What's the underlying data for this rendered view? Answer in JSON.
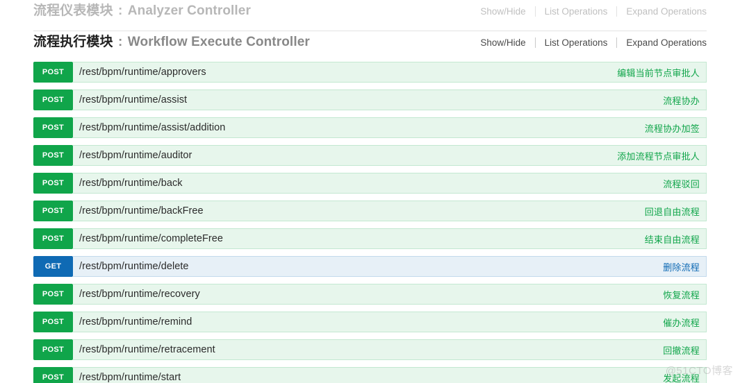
{
  "sections": [
    {
      "id": "analyzer",
      "title_cn": "流程仪表模块",
      "title_sep": " : ",
      "title_en": "Analyzer Controller",
      "state": "collapsed",
      "options": {
        "show_hide": "Show/Hide",
        "list_operations": "List Operations",
        "expand_operations": "Expand Operations"
      }
    },
    {
      "id": "workflow-execute",
      "title_cn": "流程执行模块",
      "title_sep": " : ",
      "title_en": "Workflow Execute Controller",
      "state": "expanded",
      "options": {
        "show_hide": "Show/Hide",
        "list_operations": "List Operations",
        "expand_operations": "Expand Operations"
      }
    }
  ],
  "endpoints": [
    {
      "method": "POST",
      "path": "/rest/bpm/runtime/approvers",
      "description": "编辑当前节点审批人"
    },
    {
      "method": "POST",
      "path": "/rest/bpm/runtime/assist",
      "description": "流程协办"
    },
    {
      "method": "POST",
      "path": "/rest/bpm/runtime/assist/addition",
      "description": "流程协办加签"
    },
    {
      "method": "POST",
      "path": "/rest/bpm/runtime/auditor",
      "description": "添加流程节点审批人"
    },
    {
      "method": "POST",
      "path": "/rest/bpm/runtime/back",
      "description": "流程驳回"
    },
    {
      "method": "POST",
      "path": "/rest/bpm/runtime/backFree",
      "description": "回退自由流程"
    },
    {
      "method": "POST",
      "path": "/rest/bpm/runtime/completeFree",
      "description": "结束自由流程"
    },
    {
      "method": "GET",
      "path": "/rest/bpm/runtime/delete",
      "description": "删除流程"
    },
    {
      "method": "POST",
      "path": "/rest/bpm/runtime/recovery",
      "description": "恢复流程"
    },
    {
      "method": "POST",
      "path": "/rest/bpm/runtime/remind",
      "description": "催办流程"
    },
    {
      "method": "POST",
      "path": "/rest/bpm/runtime/retracement",
      "description": "回撤流程"
    },
    {
      "method": "POST",
      "path": "/rest/bpm/runtime/start",
      "description": "发起流程"
    }
  ],
  "colors": {
    "post": "#10a54a",
    "get": "#0f6ab4",
    "post_row_bg": "#e7f6ec",
    "get_row_bg": "#e7f0f7"
  },
  "watermark": "@51CTO博客"
}
